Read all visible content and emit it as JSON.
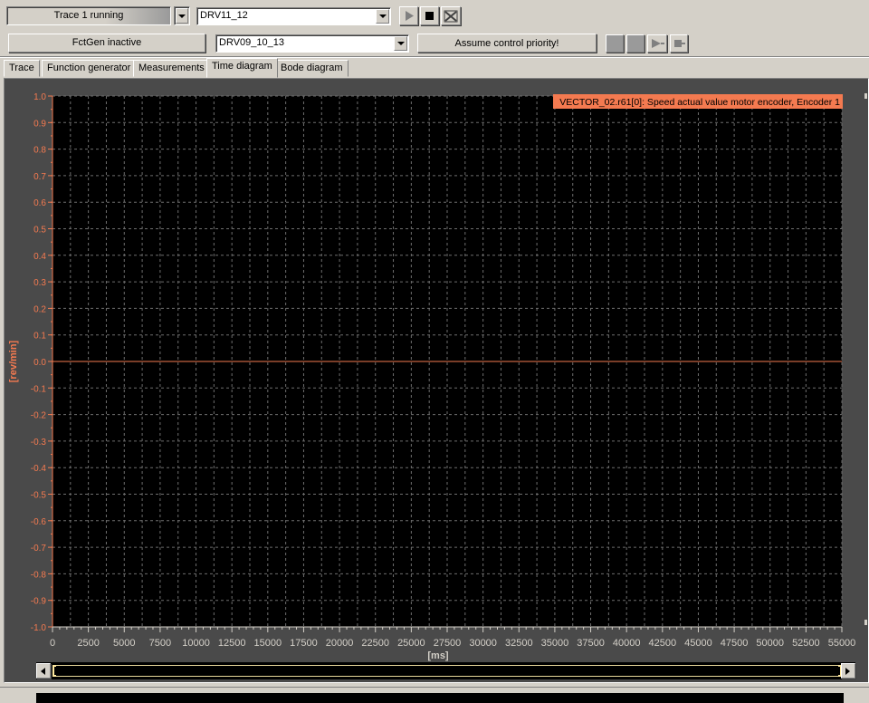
{
  "toolbar": {
    "trace_status": "Trace 1 running",
    "drive_select": "DRV11_12",
    "fctgen_status": "FctGen  inactive",
    "drive_select_2": "DRV09_10_13",
    "assume_control_label": "Assume control priority!"
  },
  "icons": {
    "play": "play-icon",
    "stop": "stop-icon",
    "reset": "reset-icon"
  },
  "tabs": [
    {
      "label": "Trace"
    },
    {
      "label": "Function generator"
    },
    {
      "label": "Measurements"
    },
    {
      "label": "Time diagram"
    },
    {
      "label": "Bode diagram"
    }
  ],
  "active_tab": "Time diagram",
  "colors": {
    "plot_bg": "#000000",
    "panel_bg": "#4a4a4a",
    "grid": "#6e6e6e",
    "accent": "#f47a50",
    "signal_line": "#f47a50"
  },
  "chart_data": {
    "type": "line",
    "legend": "VECTOR_02.r61[0]: Speed actual value motor encoder, Encoder 1",
    "ylabel": "[rev/min]",
    "xlabel": "[ms]",
    "ylim": [
      -1.0,
      1.0
    ],
    "xlim": [
      0,
      55000
    ],
    "y_ticks": [
      "1.0",
      "0.9",
      "0.8",
      "0.7",
      "0.6",
      "0.5",
      "0.4",
      "0.3",
      "0.2",
      "0.1",
      "0.0",
      "-0.1",
      "-0.2",
      "-0.3",
      "-0.4",
      "-0.5",
      "-0.6",
      "-0.7",
      "-0.8",
      "-0.9",
      "-1.0"
    ],
    "x_ticks": [
      "0",
      "2500",
      "5000",
      "7500",
      "10000",
      "12500",
      "15000",
      "17500",
      "20000",
      "22500",
      "25000",
      "27500",
      "30000",
      "32500",
      "35000",
      "37500",
      "40000",
      "42500",
      "45000",
      "47500",
      "50000",
      "52500",
      "55000"
    ],
    "grid": true,
    "series": [
      {
        "name": "VECTOR_02.r61[0]: Speed actual value motor encoder, Encoder 1",
        "x": [
          0,
          55000
        ],
        "y": [
          0.0,
          0.0
        ]
      }
    ]
  }
}
